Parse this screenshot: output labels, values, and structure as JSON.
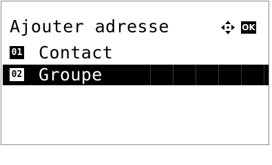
{
  "header": {
    "title": "Ajouter adresse",
    "nav_icon": "four-way-arrow-icon",
    "ok_label": "OK"
  },
  "list": {
    "items": [
      {
        "number": "01",
        "label": "Contact",
        "selected": false
      },
      {
        "number": "02",
        "label": "Groupe",
        "selected": true
      }
    ]
  },
  "colors": {
    "background": "#ffffff",
    "text": "#000000",
    "selection": "#000000",
    "selection_text": "#ffffff"
  }
}
